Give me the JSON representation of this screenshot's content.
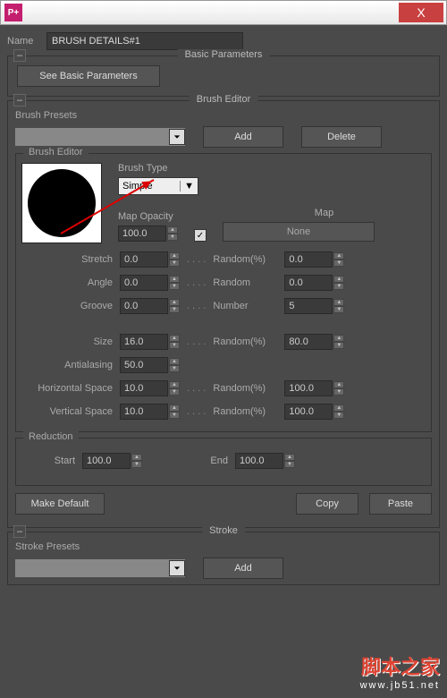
{
  "titlebar": {
    "close": "X"
  },
  "name": {
    "label": "Name",
    "value": "BRUSH DETAILS#1"
  },
  "basicParams": {
    "header": "Basic Parameters",
    "seeBtn": "See Basic Parameters"
  },
  "brushEditor": {
    "header": "Brush Editor",
    "presetsLabel": "Brush Presets",
    "addBtn": "Add",
    "deleteBtn": "Delete",
    "innerLabel": "Brush Editor",
    "brushTypeLabel": "Brush Type",
    "brushTypeValue": "Simple",
    "mapOpacityLabel": "Map Opacity",
    "mapOpacityValue": "100.0",
    "mapLabel": "Map",
    "mapBtn": "None",
    "params": {
      "stretch": {
        "label": "Stretch",
        "val": "0.0",
        "randLabel": "Random(%)",
        "randVal": "0.0"
      },
      "angle": {
        "label": "Angle",
        "val": "0.0",
        "randLabel": "Random",
        "randVal": "0.0"
      },
      "groove": {
        "label": "Groove",
        "val": "0.0",
        "randLabel": "Number",
        "randVal": "5"
      },
      "size": {
        "label": "Size",
        "val": "16.0",
        "randLabel": "Random(%)",
        "randVal": "80.0"
      },
      "antialias": {
        "label": "Antialasing",
        "val": "50.0"
      },
      "hspace": {
        "label": "Horizontal Space",
        "val": "10.0",
        "randLabel": "Random(%)",
        "randVal": "100.0"
      },
      "vspace": {
        "label": "Vertical Space",
        "val": "10.0",
        "randLabel": "Random(%)",
        "randVal": "100.0"
      }
    }
  },
  "reduction": {
    "label": "Reduction",
    "startLabel": "Start",
    "startVal": "100.0",
    "endLabel": "End",
    "endVal": "100.0"
  },
  "footer": {
    "makeDefault": "Make Default",
    "copy": "Copy",
    "paste": "Paste"
  },
  "stroke": {
    "header": "Stroke",
    "presetsLabel": "Stroke Presets",
    "addBtn": "Add"
  },
  "watermark": {
    "cn": "脚本之家",
    "en": "www.jb51.net"
  }
}
